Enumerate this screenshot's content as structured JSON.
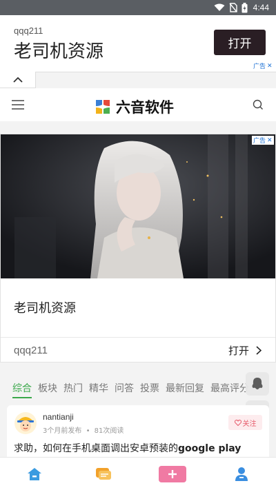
{
  "status_bar": {
    "time": "4:44",
    "icons": [
      "wifi-icon",
      "no-sim-icon",
      "battery-icon"
    ]
  },
  "top_ad": {
    "advertiser": "qqq211",
    "headline": "老司机资源",
    "open_label": "打开",
    "ad_tag": "广告",
    "ad_close": "✕"
  },
  "header": {
    "app_name": "六音软件",
    "logo_colors": [
      "#3a7fd5",
      "#e64a3a",
      "#f2b21a",
      "#4caf50"
    ]
  },
  "card_ad": {
    "ad_tag": "广告",
    "ad_close": "✕",
    "title": "老司机资源",
    "advertiser": "qqq211",
    "open_label": "打开"
  },
  "tabs": [
    {
      "label": "综合",
      "active": true
    },
    {
      "label": "板块",
      "active": false
    },
    {
      "label": "热门",
      "active": false
    },
    {
      "label": "精华",
      "active": false
    },
    {
      "label": "问答",
      "active": false
    },
    {
      "label": "投票",
      "active": false
    },
    {
      "label": "最新回复",
      "active": false
    },
    {
      "label": "最高评分",
      "active": false
    }
  ],
  "post": {
    "author": "nantianji",
    "time": "3个月前发布",
    "reads": "81次阅读",
    "follow_label": "关注",
    "title_prefix": "求助，如何在手机桌面调出安卓预装的",
    "title_bold": "google play"
  },
  "colors": {
    "accent_green": "#3aa84a",
    "follow_pink": "#e65a6a",
    "post_button": "#f07aa3",
    "home_blue": "#3a9be0",
    "chat_orange": "#f2a12a",
    "profile_blue": "#3a8ee0"
  },
  "bottom_nav": [
    "home-icon",
    "messages-icon",
    "new-post-icon",
    "profile-icon"
  ]
}
